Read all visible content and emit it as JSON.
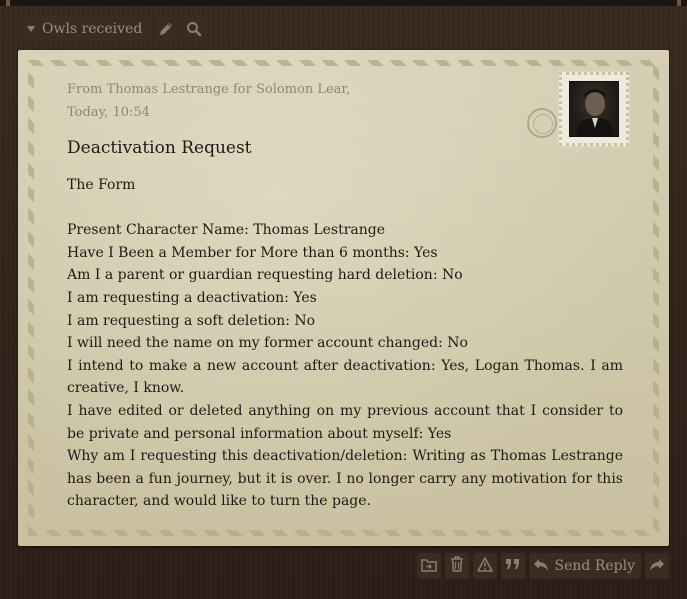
{
  "toolbar": {
    "folder_label": "Owls received",
    "folder_icon": "caret-down-icon",
    "edit_icon": "pencil-icon",
    "search_icon": "search-icon"
  },
  "letter": {
    "from_line": "From Thomas Lestrange for Solomon Lear,",
    "date_line": "Today, 10:54",
    "subject": "Deactivation Request",
    "paragraphs": [
      "The Form",
      "",
      "Present Character Name: Thomas Lestrange",
      "Have I Been a Member for More than 6 months: Yes",
      "Am I a parent or guardian requesting hard deletion: No",
      "I am requesting a deactivation: Yes",
      "I am requesting a soft deletion: No",
      "I will need the name on my former account changed: No",
      "I intend to make a new account after deactivation: Yes, Logan Thomas. I am creative, I know.",
      "I have edited or deleted anything on my previous account that I consider to be private and personal information about myself: Yes",
      "Why am I requesting this deactivation/deletion: Writing as Thomas Lestrange has been a fun journey, but it is over. I no longer carry any motivation for this character, and would like to turn the page."
    ]
  },
  "actions": {
    "move_icon": "folder-move-icon",
    "delete_icon": "trash-icon",
    "report_icon": "warning-icon",
    "quote_icon": "quote-icon",
    "reply_icon": "reply-icon",
    "reply_label": "Send Reply",
    "forward_icon": "forward-icon"
  },
  "colors": {
    "background": "#2a1f18",
    "paper": "#d0c8aa",
    "button": "#3a2c22",
    "button_text": "#9d8e7c"
  }
}
